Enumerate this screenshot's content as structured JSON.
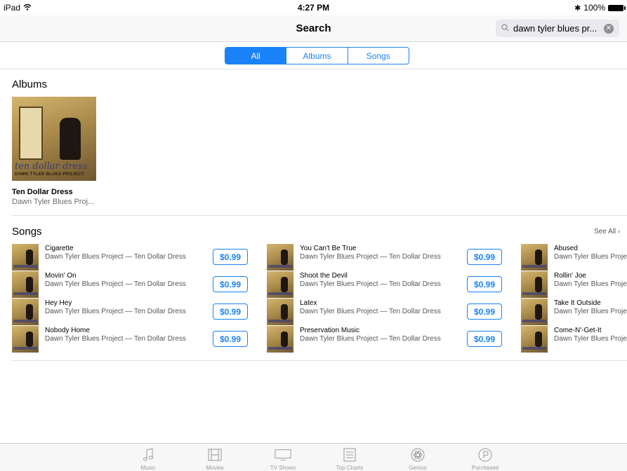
{
  "status_bar": {
    "device": "iPad",
    "time": "4:27 PM",
    "battery": "100%"
  },
  "nav": {
    "title": "Search",
    "search_text": "dawn tyler blues pr..."
  },
  "segments": [
    {
      "label": "All",
      "active": true
    },
    {
      "label": "Albums",
      "active": false
    },
    {
      "label": "Songs",
      "active": false
    }
  ],
  "albums": {
    "heading": "Albums",
    "items": [
      {
        "title": "Ten Dollar Dress",
        "artist": "Dawn Tyler Blues Proj...",
        "art_script": "ten dollar dress",
        "art_band": "DAWN TYLER BLUES PROJECT"
      }
    ]
  },
  "songs": {
    "heading": "Songs",
    "see_all": "See All",
    "columns": [
      [
        {
          "title": "Cigarette",
          "subtitle": "Dawn Tyler Blues Project — Ten Dollar Dress",
          "price": "$0.99"
        },
        {
          "title": "Movin' On",
          "subtitle": "Dawn Tyler Blues Project — Ten Dollar Dress",
          "price": "$0.99"
        },
        {
          "title": "Hey Hey",
          "subtitle": "Dawn Tyler Blues Project — Ten Dollar Dress",
          "price": "$0.99"
        },
        {
          "title": "Nobody Home",
          "subtitle": "Dawn Tyler Blues Project — Ten Dollar Dress",
          "price": "$0.99"
        }
      ],
      [
        {
          "title": "You Can't Be True",
          "subtitle": "Dawn Tyler Blues Project — Ten Dollar Dress",
          "price": "$0.99"
        },
        {
          "title": "Shoot the Devil",
          "subtitle": "Dawn Tyler Blues Project — Ten Dollar Dress",
          "price": "$0.99"
        },
        {
          "title": "Latex",
          "subtitle": "Dawn Tyler Blues Project — Ten Dollar Dress",
          "price": "$0.99"
        },
        {
          "title": "Preservation Music",
          "subtitle": "Dawn Tyler Blues Project — Ten Dollar Dress",
          "price": "$0.99"
        }
      ],
      [
        {
          "title": "Abused",
          "subtitle": "Dawn Tyler Blues Proje"
        },
        {
          "title": "Rollin' Joe",
          "subtitle": "Dawn Tyler Blues Proje"
        },
        {
          "title": "Take It Outside",
          "subtitle": "Dawn Tyler Blues Proje"
        },
        {
          "title": "Come-N'-Get-It",
          "subtitle": "Dawn Tyler Blues Proje"
        }
      ]
    ]
  },
  "tabs": [
    {
      "label": "Music",
      "icon": "music-note-icon"
    },
    {
      "label": "Movies",
      "icon": "film-icon"
    },
    {
      "label": "TV Shows",
      "icon": "tv-icon"
    },
    {
      "label": "Top Charts",
      "icon": "list-icon"
    },
    {
      "label": "Genius",
      "icon": "atom-icon"
    },
    {
      "label": "Purchased",
      "icon": "purchased-icon"
    }
  ],
  "colors": {
    "accent": "#1a82f7",
    "tab_inactive": "#999999"
  }
}
